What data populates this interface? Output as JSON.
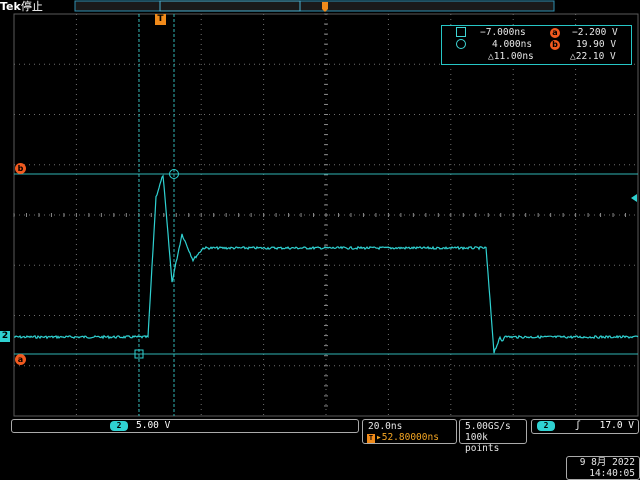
{
  "header": {
    "brand": "Tek",
    "run_state": "停止"
  },
  "cursors": {
    "a_time": "−7.000ns",
    "b_time": "4.000ns",
    "delta_time": "△11.00ns",
    "a_volt": "−2.200 V",
    "b_volt": "19.90 V",
    "delta_volt": "△22.10 V",
    "a_label": "a",
    "b_label": "b"
  },
  "markers": {
    "channel": "2",
    "trigger_position": "T"
  },
  "vertical": {
    "channel": "2",
    "scale": "5.00 V"
  },
  "horizontal": {
    "scale": "20.0ns",
    "position": "52.80000ns",
    "trigger_glyph": "T"
  },
  "acquisition": {
    "sample_rate": "5.00GS/s",
    "record_length": "100k points"
  },
  "trigger": {
    "source": "2",
    "slope_symbol": "ʃ",
    "level": "17.0 V"
  },
  "clock": {
    "date": "9 8月  2022",
    "time": "14:40:05"
  },
  "colors": {
    "trace": "#2fd1d1",
    "cursor": "#2fb5b5",
    "marker": "#f15a1f",
    "trigger": "#f08a1a",
    "graticule": "#6e6e6e"
  }
}
